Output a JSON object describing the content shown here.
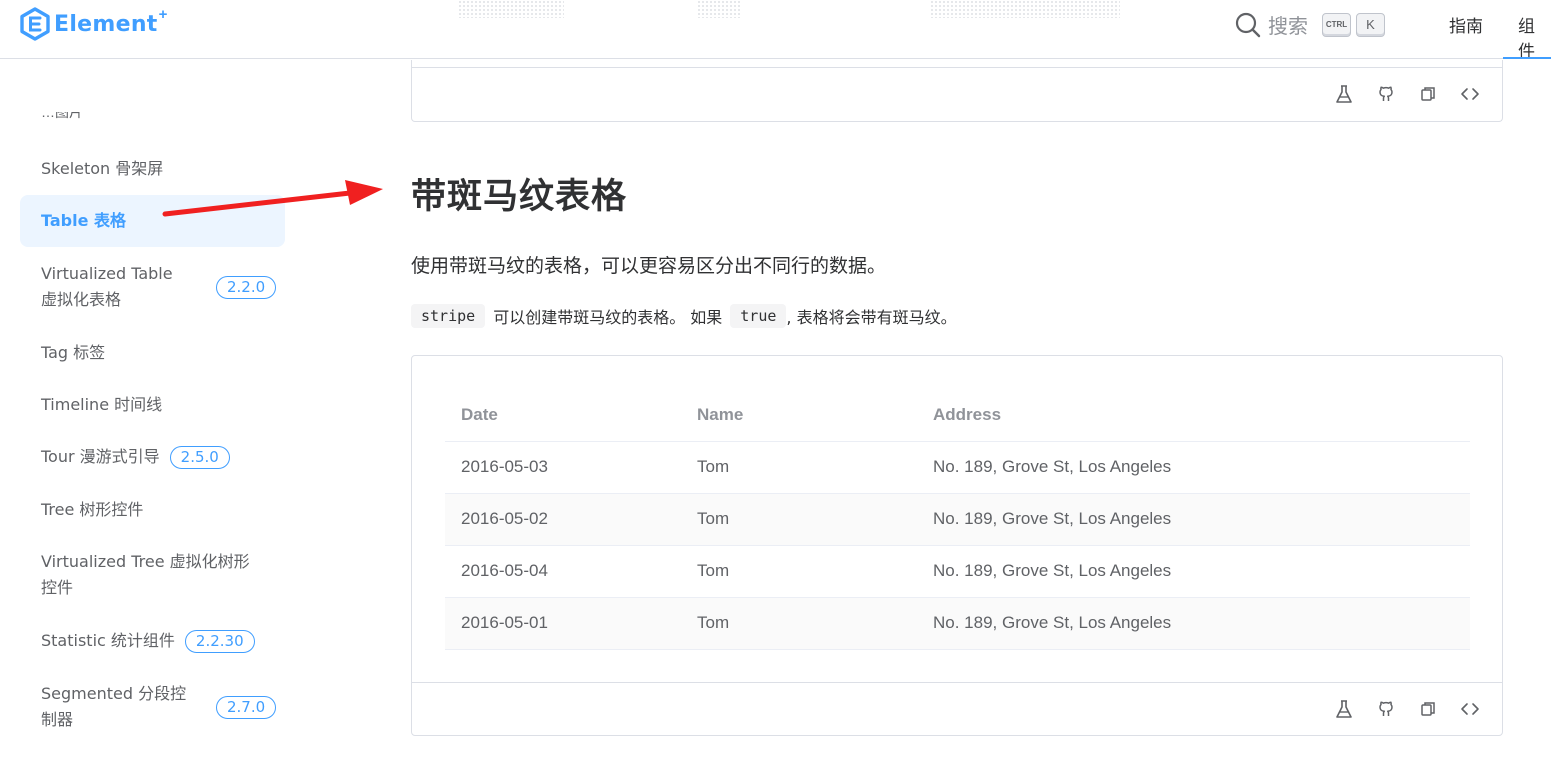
{
  "header": {
    "logo_text": "Element",
    "logo_plus": "+",
    "search_label": "搜索",
    "shortcut_ctrl": "CTRL",
    "shortcut_k": "K",
    "nav": [
      {
        "label": "指南",
        "active": false
      },
      {
        "label": "组件",
        "active": true
      }
    ]
  },
  "sidebar": {
    "partial_item": "…图片",
    "items": [
      {
        "label": "Skeleton 骨架屏"
      },
      {
        "label": "Table 表格",
        "active": true
      },
      {
        "label": "Virtualized Table 虚拟化表格",
        "badge": "2.2.0"
      },
      {
        "label": "Tag 标签"
      },
      {
        "label": "Timeline 时间线"
      },
      {
        "label": "Tour 漫游式引导",
        "badge": "2.5.0"
      },
      {
        "label": "Tree 树形控件"
      },
      {
        "label": "Virtualized Tree 虚拟化树形控件"
      },
      {
        "label": "Statistic 统计组件",
        "badge": "2.2.30"
      },
      {
        "label": "Segmented 分段控制器",
        "badge": "2.7.0"
      }
    ]
  },
  "main": {
    "section_title": "带斑马纹表格",
    "description": "使用带斑马纹的表格，可以更容易区分出不同行的数据。",
    "desc2": {
      "code1": "stripe",
      "text1": "可以创建带斑马纹的表格。 如果",
      "code2": "true",
      "text2": ", 表格将会带有斑马纹。"
    },
    "demo_ops": [
      "playground-icon",
      "github-icon",
      "copy-icon",
      "code-icon"
    ],
    "table": {
      "columns": [
        "Date",
        "Name",
        "Address"
      ],
      "rows": [
        [
          "2016-05-03",
          "Tom",
          "No. 189, Grove St, Los Angeles"
        ],
        [
          "2016-05-02",
          "Tom",
          "No. 189, Grove St, Los Angeles"
        ],
        [
          "2016-05-04",
          "Tom",
          "No. 189, Grove St, Los Angeles"
        ],
        [
          "2016-05-01",
          "Tom",
          "No. 189, Grove St, Los Angeles"
        ]
      ]
    }
  },
  "colors": {
    "accent": "#409eff",
    "active_bg": "#ecf5ff",
    "annotation_arrow": "#f02020"
  }
}
